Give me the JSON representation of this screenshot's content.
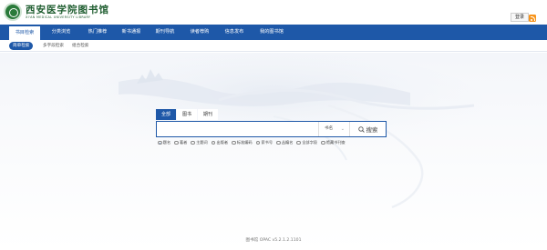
{
  "header": {
    "logo_cn": "西安医学院图书馆",
    "logo_en": "XI'AN MEDICAL UNIVERSITY LIBRARY",
    "login_label": "登录",
    "rss_icon": "rss-icon"
  },
  "nav": {
    "items": [
      {
        "label": "书目检索"
      },
      {
        "label": "分类浏览"
      },
      {
        "label": "热门推荐"
      },
      {
        "label": "新书通报"
      },
      {
        "label": "期刊导航"
      },
      {
        "label": "读者荐购"
      },
      {
        "label": "信息发布"
      },
      {
        "label": "我的图书馆"
      }
    ]
  },
  "subnav": {
    "items": [
      {
        "label": "简单检索"
      },
      {
        "label": "多字段检索"
      },
      {
        "label": "组合检索"
      }
    ]
  },
  "search": {
    "tabs": [
      {
        "label": "全部"
      },
      {
        "label": "图书"
      },
      {
        "label": "期刊"
      }
    ],
    "input_value": "",
    "input_placeholder": "",
    "scope_value": "书名",
    "button_label": "搜索",
    "filters": [
      {
        "label": "题名",
        "checked": true
      },
      {
        "label": "著者",
        "checked": false
      },
      {
        "label": "主题词",
        "checked": false
      },
      {
        "label": "出版者",
        "checked": false
      },
      {
        "label": "标准编码",
        "checked": false
      },
      {
        "label": "索书号",
        "checked": false
      },
      {
        "label": "丛编名",
        "checked": false
      },
      {
        "label": "全部字段",
        "checked": false
      },
      {
        "label": "馆藏书刊查",
        "checked": false
      }
    ]
  },
  "footer": {
    "text": "图书馆 OPAC v5.2.1.2.1101"
  },
  "colors": {
    "accent": "#1e58a8",
    "brand_green": "#1d5c2e",
    "rss": "#f7941d"
  }
}
